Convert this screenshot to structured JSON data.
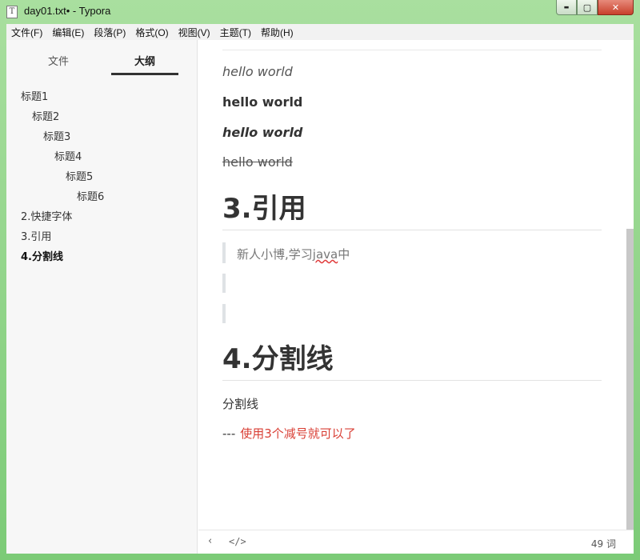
{
  "window": {
    "title": "day01.txt• - Typora",
    "app_icon": "T"
  },
  "window_controls": {
    "minimize": "▬",
    "maximize": "▢",
    "close": "✕"
  },
  "menu": [
    {
      "label": "文件(F)"
    },
    {
      "label": "编辑(E)"
    },
    {
      "label": "段落(P)"
    },
    {
      "label": "格式(O)"
    },
    {
      "label": "视图(V)"
    },
    {
      "label": "主题(T)"
    },
    {
      "label": "帮助(H)"
    }
  ],
  "sidebar": {
    "tabs": {
      "files": "文件",
      "outline": "大纲"
    },
    "outline": [
      {
        "label": "标题1",
        "level": 1
      },
      {
        "label": "标题2",
        "level": 2
      },
      {
        "label": "标题3",
        "level": 3
      },
      {
        "label": "标题4",
        "level": 4
      },
      {
        "label": "标题5",
        "level": 5
      },
      {
        "label": "标题6",
        "level": 6
      },
      {
        "label": "2.快捷字体",
        "level": 1
      },
      {
        "label": "3.引用",
        "level": 1
      },
      {
        "label": "4.分割线",
        "level": 1,
        "active": true
      }
    ]
  },
  "editor": {
    "italic_text": "hello world",
    "bold_text": "hello world",
    "bold_italic_text": "hello world",
    "strike_text": "hello world",
    "heading_quote": "3.引用",
    "quote_before": "新人小博,学习",
    "quote_misspelled": "java",
    "quote_after": "中",
    "heading_divider": "4.分割线",
    "divider_label": "分割线",
    "dashes": "---",
    "dashes_note": "使用3个减号就可以了"
  },
  "footer": {
    "back_icon": "‹",
    "source_icon": "</>",
    "word_count": "49 词"
  },
  "colors": {
    "accent_red": "#d93f35",
    "window_frame": "#8fd38a"
  }
}
